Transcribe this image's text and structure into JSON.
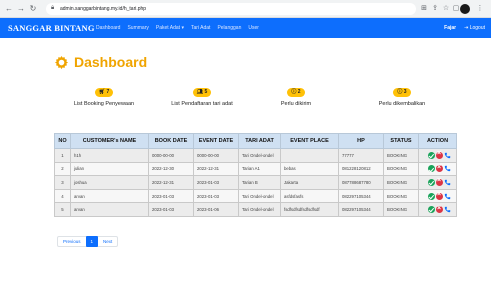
{
  "browser": {
    "url": "admin.sanggarbintang.my.id/h_tari.php"
  },
  "navbar": {
    "brand": "SANGGAR BINTANG",
    "links": [
      "Dashboard",
      "Summary",
      "Paket Adat ▾",
      "Tari Adat",
      "Pelanggan",
      "User"
    ],
    "user": "Fajar",
    "logout": "Logout"
  },
  "page": {
    "title": "Dashboard"
  },
  "cards": [
    {
      "count": "7",
      "label": "List Booking Penyewaan"
    },
    {
      "count": "5",
      "label": "List Pendaftaran tari adat"
    },
    {
      "count": "2",
      "label": "Perlu dikirim"
    },
    {
      "count": "3",
      "label": "Perlu dikembalikan"
    }
  ],
  "table": {
    "headers": [
      "NO",
      "CUSTOMER's NAME",
      "BOOK DATE",
      "EVENT DATE",
      "TARI ADAT",
      "EVENT PLACE",
      "HP",
      "STATUS",
      "ACTION"
    ],
    "rows": [
      [
        "1",
        "h1h",
        "0000-00-00",
        "0000-00-00",
        "Tari Ondel-ondel",
        "",
        "77777",
        "BOOKING"
      ],
      [
        "2",
        "julian",
        "2022-12-30",
        "2022-12-31",
        "Tarian A1",
        "bebas",
        "081228120812",
        "BOOKING"
      ],
      [
        "3",
        "joshua",
        "2022-12-31",
        "2023-01-03",
        "Tarian B",
        "Jakarta",
        "087788687780",
        "BOOKING"
      ],
      [
        "4",
        "arvan",
        "2023-01-03",
        "2023-01-03",
        "Tari Ondel-ondel",
        "asfdsfasfs",
        "082297105344",
        "BOOKING"
      ],
      [
        "5",
        "arvan",
        "2023-01-03",
        "2023-01-06",
        "Tari Ondel-ondel",
        "fsdfsdfsdfsdfsdfsdf",
        "082297105344",
        "BOOKING"
      ]
    ]
  },
  "pagination": {
    "previous": "Previous",
    "current": "1",
    "next": "Next"
  },
  "colors": {
    "navbar": "#0d6efd",
    "title": "#f0a400",
    "badge": "#ffc107",
    "table_header": "#cfe0f2"
  }
}
